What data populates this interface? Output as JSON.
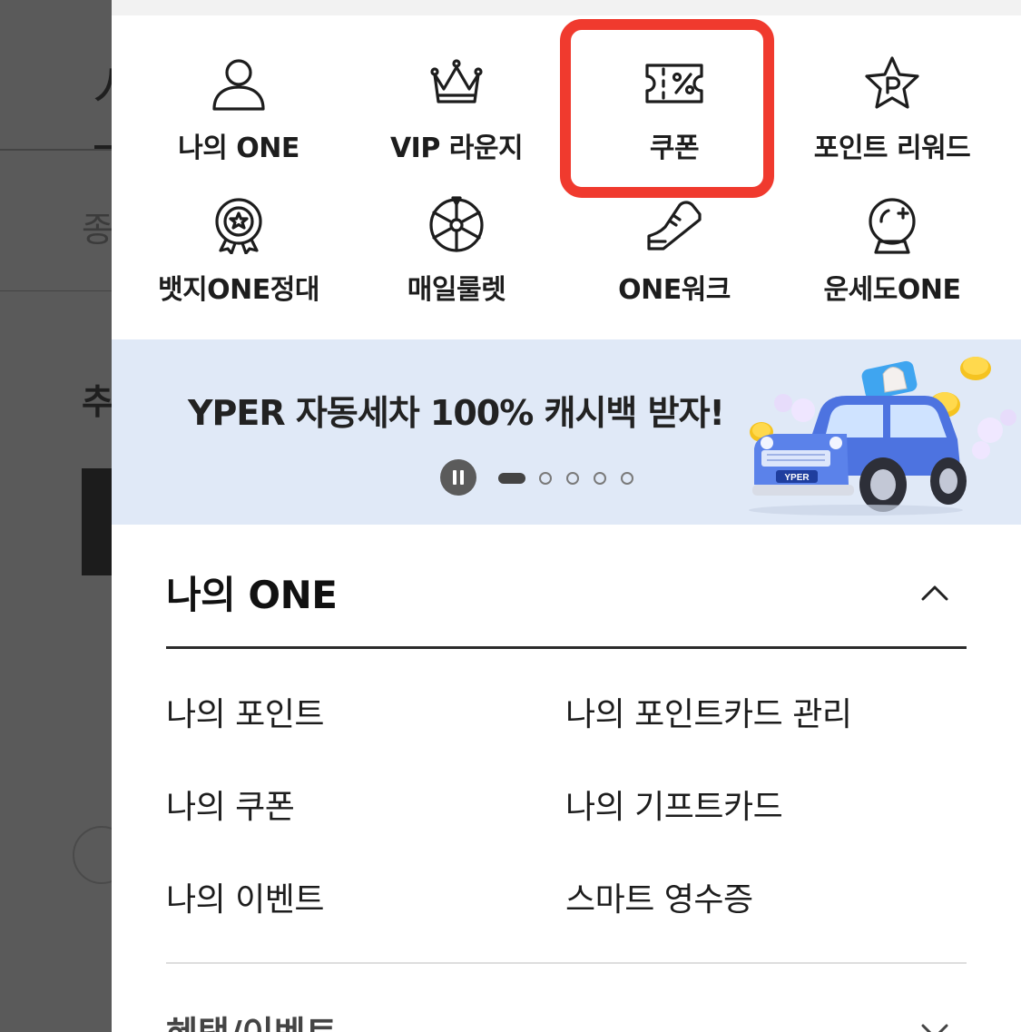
{
  "background": {
    "partial_texts": [
      "人",
      "종",
      "추"
    ]
  },
  "quick_menu": [
    {
      "label": "나의 ONE",
      "icon": "person-icon"
    },
    {
      "label": "VIP 라운지",
      "icon": "crown-icon"
    },
    {
      "label": "쿠폰",
      "icon": "coupon-icon"
    },
    {
      "label": "포인트 리워드",
      "icon": "point-star-icon"
    },
    {
      "label": "뱃지ONE정대",
      "icon": "badge-icon"
    },
    {
      "label": "매일룰렛",
      "icon": "roulette-icon"
    },
    {
      "label": "ONE워크",
      "icon": "sneaker-icon"
    },
    {
      "label": "운세도ONE",
      "icon": "crystal-ball-icon"
    }
  ],
  "highlight": {
    "target": "쿠폰",
    "color": "#f03a2e"
  },
  "banner": {
    "title": "YPER 자동세차 100% 캐시백 받자!",
    "car_plate": "YPER",
    "slide_index": 1,
    "slide_count": 5,
    "background_color": "#e0e9f7"
  },
  "section_my_one": {
    "title": "나의 ONE",
    "expanded": true,
    "links": [
      [
        "나의 포인트",
        "나의 포인트카드 관리"
      ],
      [
        "나의 쿠폰",
        "나의 기프트카드"
      ],
      [
        "나의 이벤트",
        "스마트 영수증"
      ]
    ]
  },
  "section_benefits": {
    "title": "혜택/이벤트",
    "expanded": false
  }
}
